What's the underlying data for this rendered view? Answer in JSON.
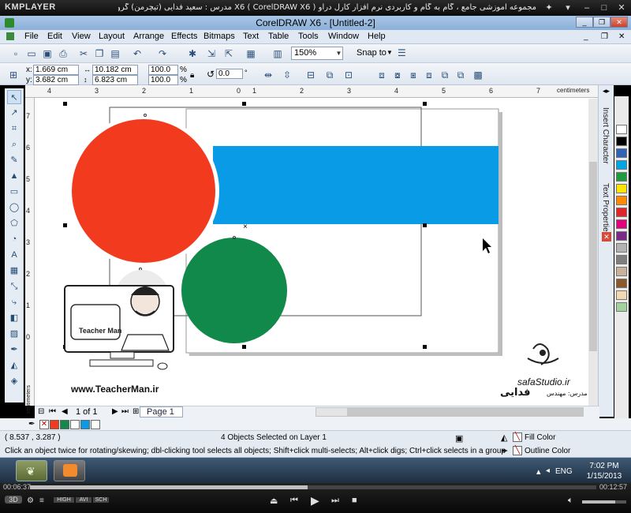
{
  "player": {
    "brand": "KMPLAYER",
    "title": "مجموعه آموزشی جامع ، گام به گام و کاربردی نرم افزار کارل دراو X6  ( CorelDRAW X6 )   مدرس : سعید فدایی (تیچرمن) گروه آموزشی پادشاه گرافیست ها",
    "elapsed": "00:06:37",
    "total": "00:12:57",
    "progress_fraction": 0.49,
    "quality_badges": [
      "3D",
      "HIGH",
      "AVI",
      "SCH"
    ]
  },
  "window": {
    "title": "CorelDRAW X6 - [Untitled-2]"
  },
  "menu": [
    "File",
    "Edit",
    "View",
    "Layout",
    "Arrange",
    "Effects",
    "Bitmaps",
    "Text",
    "Table",
    "Tools",
    "Window",
    "Help"
  ],
  "toolbar": {
    "zoom": "150%",
    "snap_label": "Snap to"
  },
  "property_bar": {
    "x": "1.669 cm",
    "y": "3.682 cm",
    "w": "10.182 cm",
    "h": "6.823 cm",
    "scale_x": "100.0",
    "scale_y": "100.0",
    "pct": "%",
    "angle": "0.0",
    "x_label": "x:",
    "y_label": "y:"
  },
  "rulers": {
    "unit": "centimeters",
    "top_ticks": [
      "4",
      "3",
      "2",
      "1",
      "0",
      "1",
      "2",
      "3",
      "4",
      "5",
      "6",
      "7"
    ],
    "left_ticks": [
      "7",
      "6",
      "5",
      "4",
      "3",
      "2",
      "1",
      "0"
    ]
  },
  "docker_tabs": [
    "Insert Character",
    "Text Properties"
  ],
  "palette": {
    "colors": [
      "#ffffff",
      "#000000",
      "#2e63b8",
      "#00a6e4",
      "#1f9b3f",
      "#ffe600",
      "#ff8a00",
      "#e0262b",
      "#e3007e",
      "#7a2a87",
      "#b3b3b3",
      "#7f7f7f",
      "#c8b39a",
      "#8a5a2b",
      "#f3d9b1",
      "#a3d39c"
    ]
  },
  "pagebar": {
    "page_count": "1 of 1",
    "page_tab": "Page 1"
  },
  "status": {
    "coords": "( 8.537 , 3.287 )",
    "selection": "4 Objects Selected on Layer 1",
    "hint": "Click an object twice for rotating/skewing; dbl-clicking tool selects all objects; Shift+click multi-selects; Alt+click digs; Ctrl+click selects in a group",
    "fill": "Fill Color",
    "outline": "Outline Color"
  },
  "watermark": {
    "site": "www.TeacherMan.ir",
    "logo_text": "Teacher Man",
    "studio": "safaStudio.ir",
    "instructor_label": "مدرس: مهندس",
    "instructor_name": "فدایی"
  },
  "taskbar": {
    "lang": "ENG",
    "time": "7:02 PM",
    "date": "1/15/2013"
  },
  "colors": {
    "red_circle": "#f23a1f",
    "blue_band": "#0a9be6",
    "green_circle": "#10894a"
  }
}
